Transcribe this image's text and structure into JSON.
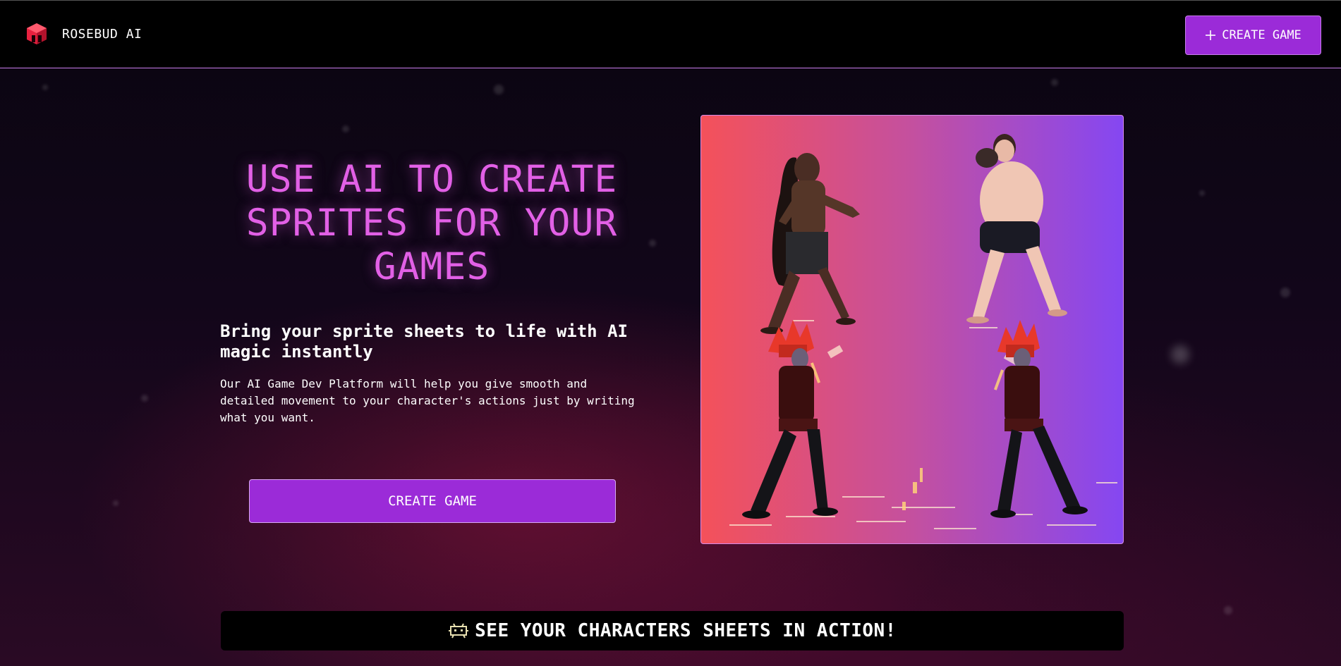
{
  "header": {
    "logo_icon": "rosebud-cube-logo-icon",
    "brand_name": "ROSEBUD AI",
    "cta_icon": "plus-icon",
    "cta_label": "CREATE GAME"
  },
  "hero": {
    "title": "USE AI TO CREATE SPRITES FOR YOUR GAMES",
    "subtitle": "Bring your sprite sheets to life with AI magic instantly",
    "description": "Our AI Game Dev Platform will help you give smooth and detailed movement to your character's actions just by writing what you want.",
    "cta_label": "CREATE GAME"
  },
  "sprite_preview": {
    "image": "sprite-sheet-fighters-image",
    "gradient_colors": [
      "#f4515a",
      "#c4509f",
      "#8547f2"
    ]
  },
  "banner": {
    "icon": "space-invader-icon",
    "text": "SEE YOUR CHARACTERS SHEETS IN ACTION!"
  },
  "colors": {
    "accent": "#9b2bd8",
    "title_pink": "#e260e6",
    "header_border": "#c77dea"
  }
}
